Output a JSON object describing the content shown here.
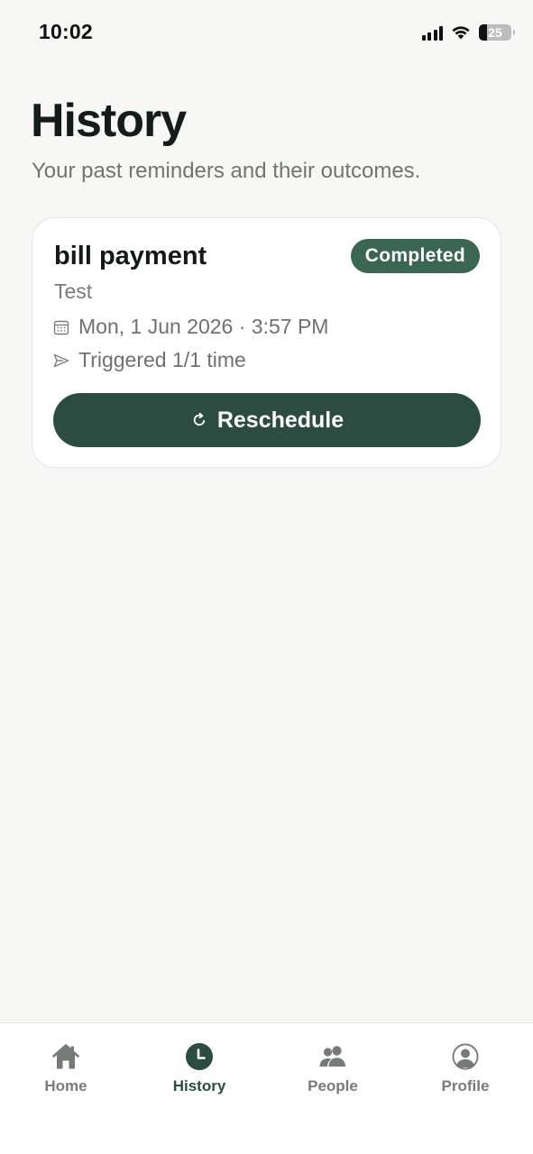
{
  "status_bar": {
    "time": "10:02",
    "battery": "25",
    "battery_level": 0.25
  },
  "header": {
    "title": "History",
    "subtitle": "Your past reminders and their outcomes."
  },
  "reminders": [
    {
      "title": "bill payment",
      "status": "Completed",
      "note": "Test",
      "datetime": "Mon, 1 Jun 2026 · 3:57 PM",
      "triggered": "Triggered 1/1 time",
      "action_label": "Reschedule",
      "icons": {
        "date": "calendar-icon",
        "triggered": "send-icon",
        "action": "refresh-icon"
      }
    }
  ],
  "tab_bar": {
    "active": "History",
    "tabs": [
      {
        "label": "Home",
        "icon": "home-icon"
      },
      {
        "label": "History",
        "icon": "clock-icon"
      },
      {
        "label": "People",
        "icon": "people-icon"
      },
      {
        "label": "Profile",
        "icon": "profile-icon"
      }
    ]
  },
  "colors": {
    "background": "#f7f7f5",
    "accent": "#2c4c42",
    "badge": "#3b6651",
    "muted_text": "#777c78"
  }
}
